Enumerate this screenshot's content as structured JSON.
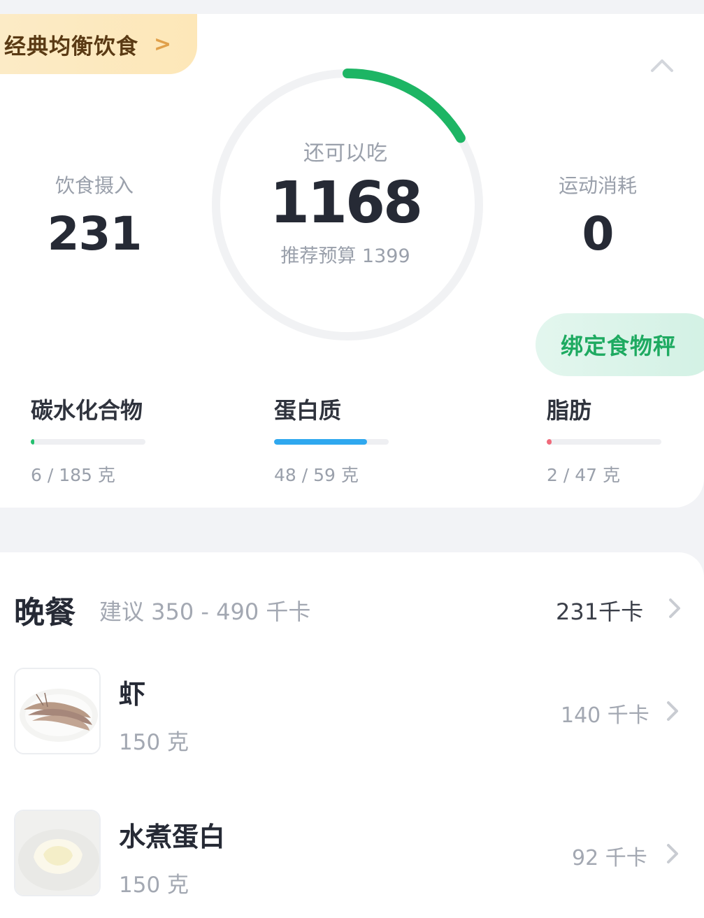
{
  "plan": {
    "label": "经典均衡饮食",
    "chevron": ">"
  },
  "summary": {
    "intake_label": "饮食摄入",
    "intake_value": "231",
    "remaining_label": "还可以吃",
    "remaining_value": "1168",
    "budget_text": "推荐预算 1399",
    "burn_label": "运动消耗",
    "burn_value": "0",
    "ring_progress": 0.165,
    "ring_color": "#1db564",
    "ring_track_color": "#f1f2f4"
  },
  "bind_scale_label": "绑定食物秤",
  "macros": [
    {
      "name": "碳水化合物",
      "amount": "6 / 185 克",
      "progress": 0.032,
      "color": "#25c06f"
    },
    {
      "name": "蛋白质",
      "amount": "48 / 59 克",
      "progress": 0.81,
      "color": "#2fa8ef"
    },
    {
      "name": "脂肪",
      "amount": "2 / 47 克",
      "progress": 0.043,
      "color": "#f06a7a"
    }
  ],
  "meal": {
    "title": "晚餐",
    "advice": "建议 350 - 490 千卡",
    "total": "231千卡",
    "items": [
      {
        "name": "虾",
        "amount": "150 克",
        "kcal": "140 千卡",
        "image": "shrimp-photo"
      },
      {
        "name": "水煮蛋白",
        "amount": "150 克",
        "kcal": "92 千卡",
        "image": "boiled-egg-white-photo"
      }
    ]
  },
  "icons": {
    "collapse": "chevron-up-icon",
    "row_arrow": "chevron-right-icon"
  }
}
